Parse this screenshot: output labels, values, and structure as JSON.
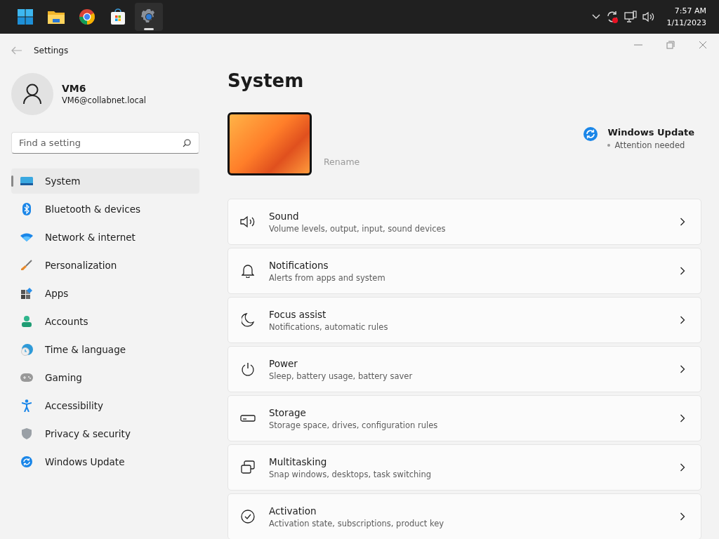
{
  "taskbar": {
    "apps": [
      {
        "selected": false
      },
      {
        "selected": false
      },
      {
        "selected": false
      },
      {
        "selected": false
      },
      {
        "selected": true
      }
    ],
    "time": "7:57 AM",
    "date": "1/11/2023"
  },
  "window": {
    "title": "Settings"
  },
  "profile": {
    "name": "VM6",
    "email": "VM6@collabnet.local"
  },
  "search": {
    "placeholder": "Find a setting"
  },
  "nav": [
    {
      "label": "System",
      "selected": true
    },
    {
      "label": "Bluetooth & devices",
      "selected": false
    },
    {
      "label": "Network & internet",
      "selected": false
    },
    {
      "label": "Personalization",
      "selected": false
    },
    {
      "label": "Apps",
      "selected": false
    },
    {
      "label": "Accounts",
      "selected": false
    },
    {
      "label": "Time & language",
      "selected": false
    },
    {
      "label": "Gaming",
      "selected": false
    },
    {
      "label": "Accessibility",
      "selected": false
    },
    {
      "label": "Privacy & security",
      "selected": false
    },
    {
      "label": "Windows Update",
      "selected": false
    }
  ],
  "main": {
    "heading": "System",
    "rename": "Rename",
    "update": {
      "title": "Windows Update",
      "status": "Attention needed"
    },
    "cards": [
      {
        "title": "Sound",
        "subtitle": "Volume levels, output, input, sound devices"
      },
      {
        "title": "Notifications",
        "subtitle": "Alerts from apps and system"
      },
      {
        "title": "Focus assist",
        "subtitle": "Notifications, automatic rules"
      },
      {
        "title": "Power",
        "subtitle": "Sleep, battery usage, battery saver"
      },
      {
        "title": "Storage",
        "subtitle": "Storage space, drives, configuration rules"
      },
      {
        "title": "Multitasking",
        "subtitle": "Snap windows, desktops, task switching"
      },
      {
        "title": "Activation",
        "subtitle": "Activation state, subscriptions, product key"
      }
    ]
  }
}
